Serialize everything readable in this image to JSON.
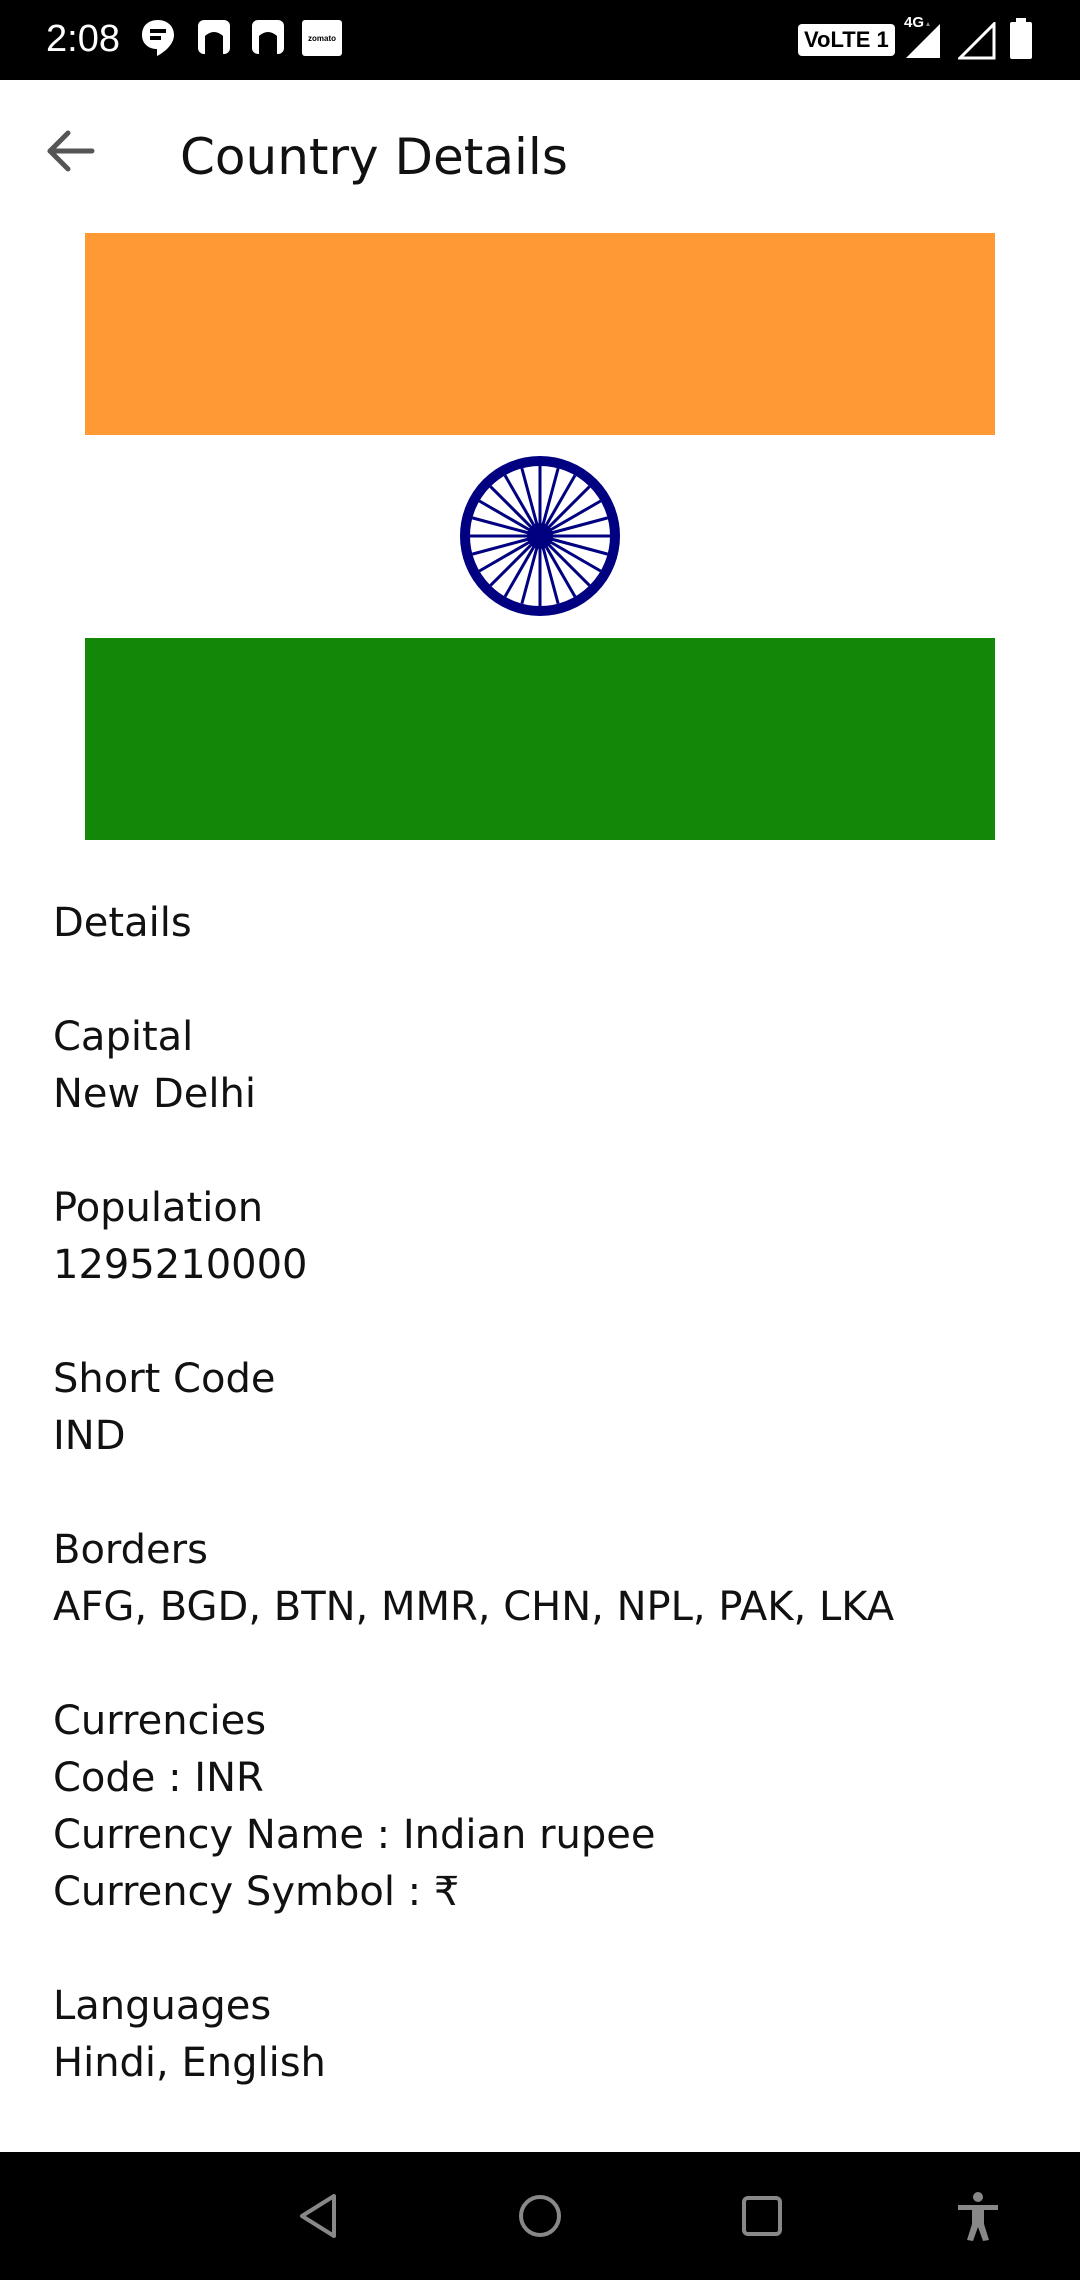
{
  "status_bar": {
    "time": "2:08",
    "notification_icons": [
      "hangouts-icon",
      "app-icon",
      "app-icon",
      "zomato-icon"
    ],
    "zomato_label": "zomato",
    "volte_label": "VoLTE 1",
    "network_label": "4G",
    "icons": [
      "signal-icon",
      "signal-empty-icon",
      "battery-icon"
    ]
  },
  "app_bar": {
    "back_icon": "arrow-left-icon",
    "title": "Country Details"
  },
  "flag": {
    "country": "India",
    "colors": {
      "saffron": "#FF9933",
      "white": "#FFFFFF",
      "green": "#138808",
      "chakra": "#000080"
    }
  },
  "details": {
    "heading": "Details",
    "capital_label": "Capital",
    "capital_value": "New Delhi",
    "population_label": "Population",
    "population_value": "1295210000",
    "short_code_label": "Short Code",
    "short_code_value": "IND",
    "borders_label": "Borders",
    "borders_value": "AFG, BGD, BTN, MMR, CHN, NPL, PAK, LKA",
    "currencies_label": "Currencies",
    "currency_code": "Code : INR",
    "currency_name": "Currency Name : Indian rupee",
    "currency_symbol": "Currency Symbol : ₹",
    "languages_label": "Languages",
    "languages_value": "Hindi, English"
  },
  "nav_bar": {
    "buttons": [
      "back-triangle-icon",
      "home-circle-icon",
      "recents-square-icon",
      "accessibility-icon"
    ]
  }
}
